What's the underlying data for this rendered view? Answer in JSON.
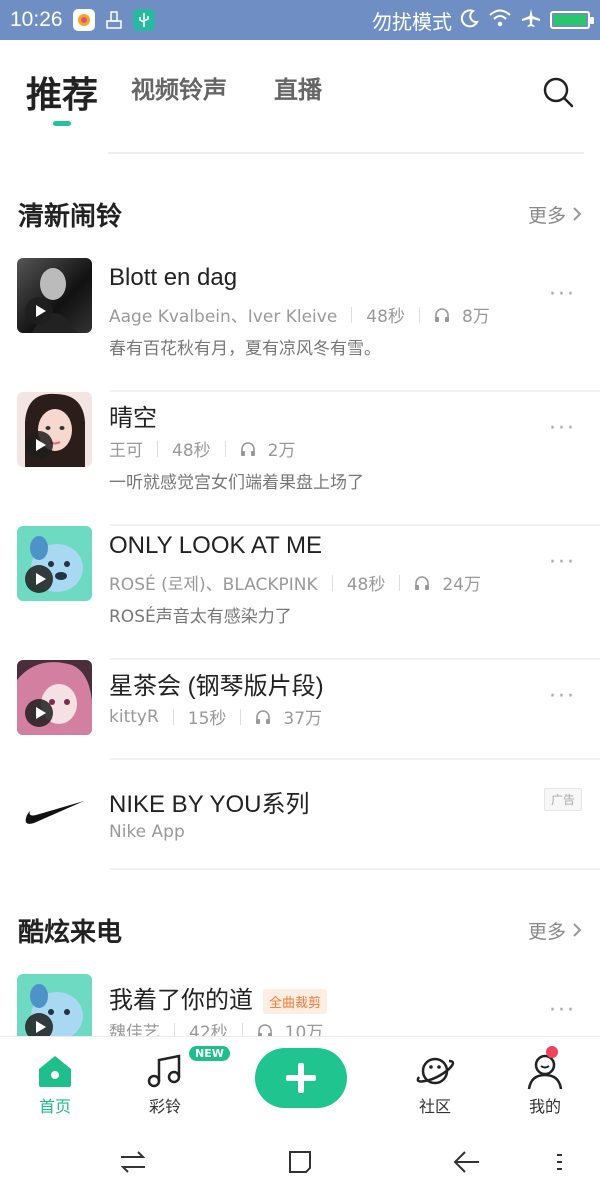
{
  "status_bar": {
    "time": "10:26",
    "dnd_label": "勿扰模式"
  },
  "top_tabs": [
    {
      "label": "推荐"
    },
    {
      "label": "视频铃声"
    },
    {
      "label": "直播"
    }
  ],
  "sections": [
    {
      "title": "清新闹铃",
      "more": "更多",
      "items": [
        {
          "title": "Blott en dag",
          "artist": "Aage Kvalbein、Iver Kleive",
          "duration": "48秒",
          "plays": "8万",
          "desc": "春有百花秋有月，夏有凉风冬有雪。"
        },
        {
          "title": "晴空",
          "artist": "王可",
          "duration": "48秒",
          "plays": "2万",
          "desc": "一听就感觉宫女们端着果盘上场了"
        },
        {
          "title": "ONLY LOOK AT ME",
          "artist": "ROSÉ (로제)、BLACKPINK",
          "duration": "48秒",
          "plays": "24万",
          "desc": "ROSÉ声音太有感染力了"
        },
        {
          "title": "星茶会 (钢琴版片段)",
          "artist": "kittyR",
          "duration": "15秒",
          "plays": "37万",
          "desc": ""
        }
      ]
    },
    {
      "title": "酷炫来电",
      "more": "更多",
      "items": [
        {
          "title": "我着了你的道",
          "tag": "全曲裁剪",
          "artist": "魏佳艺",
          "duration": "42秒",
          "plays": "10万"
        }
      ]
    }
  ],
  "ad": {
    "title": "NIKE BY YOU系列",
    "subtitle": "Nike App",
    "tag": "广告"
  },
  "bottom_nav": [
    {
      "label": "首页"
    },
    {
      "label": "彩铃",
      "badge": "NEW"
    },
    {
      "label": ""
    },
    {
      "label": "社区"
    },
    {
      "label": "我的"
    }
  ],
  "colors": {
    "accent": "#1fc48f",
    "status_bar": "#6f8fc4",
    "tag_orange": "#f07b3c",
    "badge_red": "#f0445a"
  }
}
